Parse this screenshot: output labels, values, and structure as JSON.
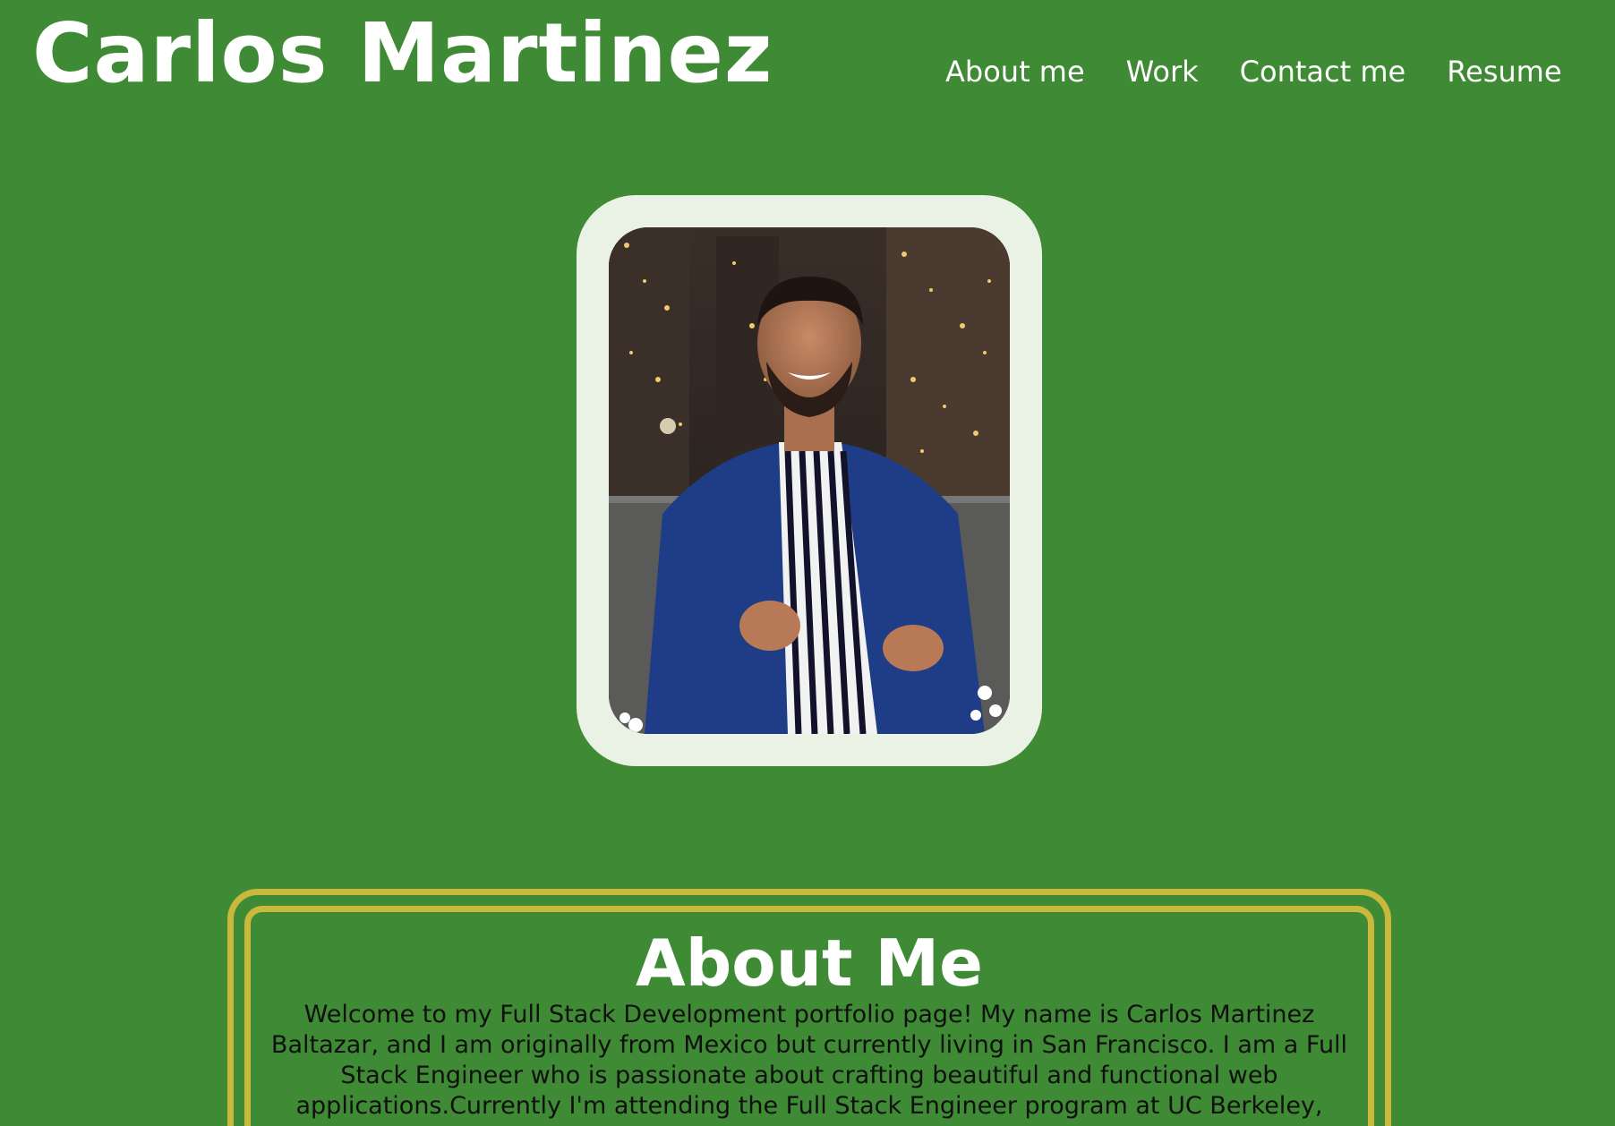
{
  "header": {
    "site_title": "Carlos Martinez"
  },
  "nav": {
    "items": [
      {
        "label": "About me"
      },
      {
        "label": "Work"
      },
      {
        "label": "Contact me"
      },
      {
        "label": "Resume"
      }
    ]
  },
  "profile_photo": {
    "subject": "portrait-photo"
  },
  "about": {
    "title": "About Me",
    "text": "Welcome to my Full Stack Development portfolio page! My name is Carlos Martinez Baltazar, and I am originally from Mexico but currently living in San Francisco. I am a Full Stack Engineer who is passionate about crafting beautiful and functional web applications.Currently I'm attending the Full Stack Engineer program at UC Berkeley,"
  },
  "colors": {
    "background": "#3f8a34",
    "frame": "#eaf2e6",
    "border_gold": "#c8b83c",
    "heading_text": "#ffffff",
    "body_text": "#101010"
  }
}
